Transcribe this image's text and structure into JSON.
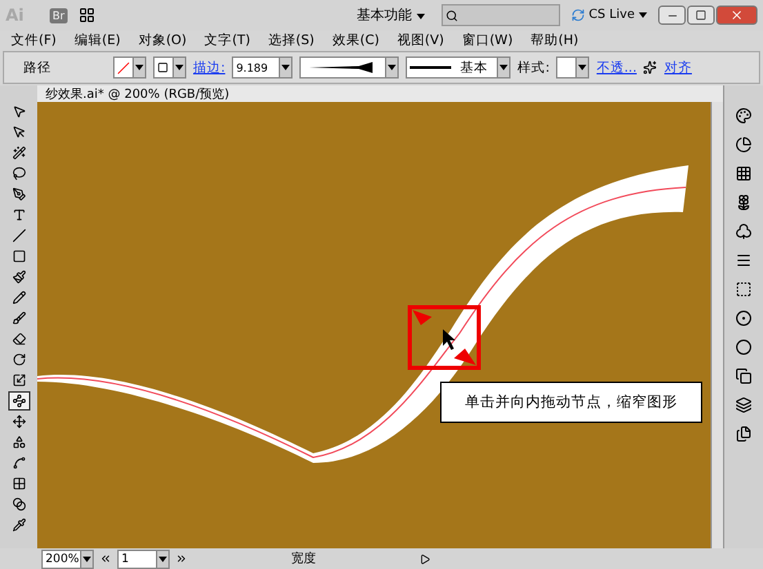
{
  "app_bar": {
    "logo": "Ai",
    "bridge": "Br",
    "workspace": "基本功能",
    "cs_live": "CS Live"
  },
  "menu": [
    "文件(F)",
    "编辑(E)",
    "对象(O)",
    "文字(T)",
    "选择(S)",
    "效果(C)",
    "视图(V)",
    "窗口(W)",
    "帮助(H)"
  ],
  "control_bar": {
    "object_type": "路径",
    "stroke_label": "描边:",
    "stroke_weight": "9.189",
    "profile": "基本",
    "style_label": "样式:",
    "opacity_link": "不透...",
    "align_link": "对齐"
  },
  "document_tab": {
    "title": "纱效果.ai* @ 200% (RGB/预览)"
  },
  "tools": [
    {
      "selected": false
    },
    {
      "selected": false
    },
    {
      "selected": false
    },
    {
      "selected": false
    },
    {
      "selected": false
    },
    {
      "selected": false
    },
    {
      "selected": false
    },
    {
      "selected": false
    },
    {
      "selected": false
    },
    {
      "selected": false
    },
    {
      "selected": false
    },
    {
      "selected": false
    },
    {
      "selected": false
    },
    {
      "selected": false
    },
    {
      "selected": true
    },
    {
      "selected": false
    },
    {
      "selected": false
    },
    {
      "selected": false
    },
    {
      "selected": false
    },
    {
      "selected": false
    },
    {
      "selected": false
    }
  ],
  "callout": "单击并向内拖动节点，缩窄图形",
  "status_bar": {
    "zoom": "200%",
    "artboard": "1",
    "status": "宽度"
  }
}
